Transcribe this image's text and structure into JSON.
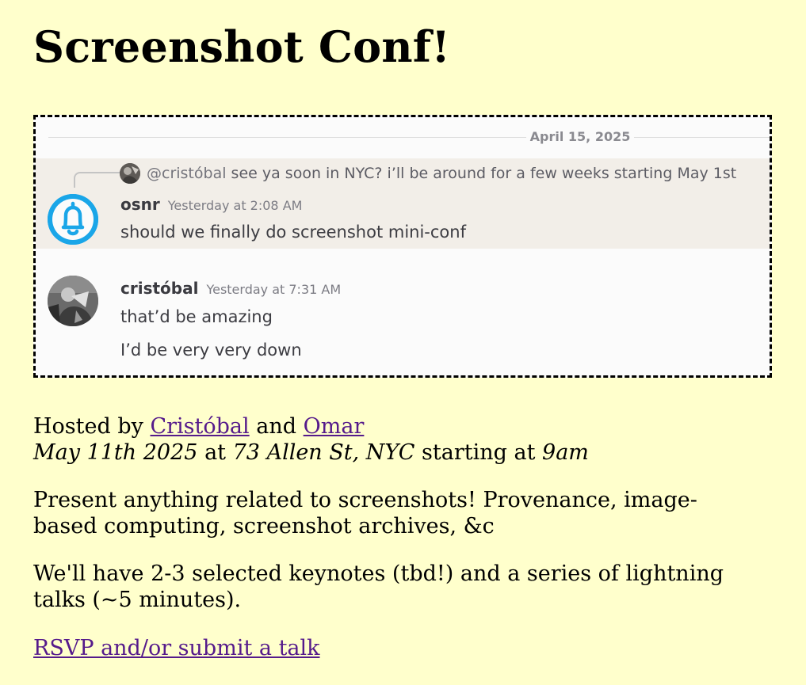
{
  "page": {
    "title": "Screenshot Conf!",
    "colors": {
      "background": "#ffffcc",
      "link": "#551a8b"
    }
  },
  "screenshot": {
    "date_divider": "April 15, 2025",
    "reply_preview": {
      "mention": "@cristóbal",
      "text": "see ya soon in NYC? i’ll be around for a few weeks starting May 1st"
    },
    "messages": [
      {
        "author": "osnr",
        "timestamp": "Yesterday at 2:08 AM",
        "lines": [
          "should we finally do screenshot mini-conf"
        ],
        "avatar_icon": "bell-icon",
        "highlighted": true
      },
      {
        "author": "cristóbal",
        "timestamp": "Yesterday at 7:31 AM",
        "lines": [
          "that’d be amazing",
          "I’d be very very down"
        ],
        "avatar_icon": "user-photo-icon",
        "highlighted": false
      }
    ]
  },
  "info": {
    "hosted_prefix": "Hosted by",
    "host1": "Cristóbal",
    "and_word": "and",
    "host2": "Omar",
    "date": "May 11th 2025",
    "at_word": "at",
    "location": "73 Allen St, NYC",
    "starting_at": "starting at",
    "time": "9am",
    "description_line1": "Present anything related to screenshots! Provenance, image-",
    "description_line2": "based computing, screenshot archives, &c",
    "talks_line1": "We'll have 2-3 selected keynotes (tbd!) and a series of lightning",
    "talks_line2": "talks (~5 minutes).",
    "rsvp_link": "RSVP and/or submit a talk"
  }
}
